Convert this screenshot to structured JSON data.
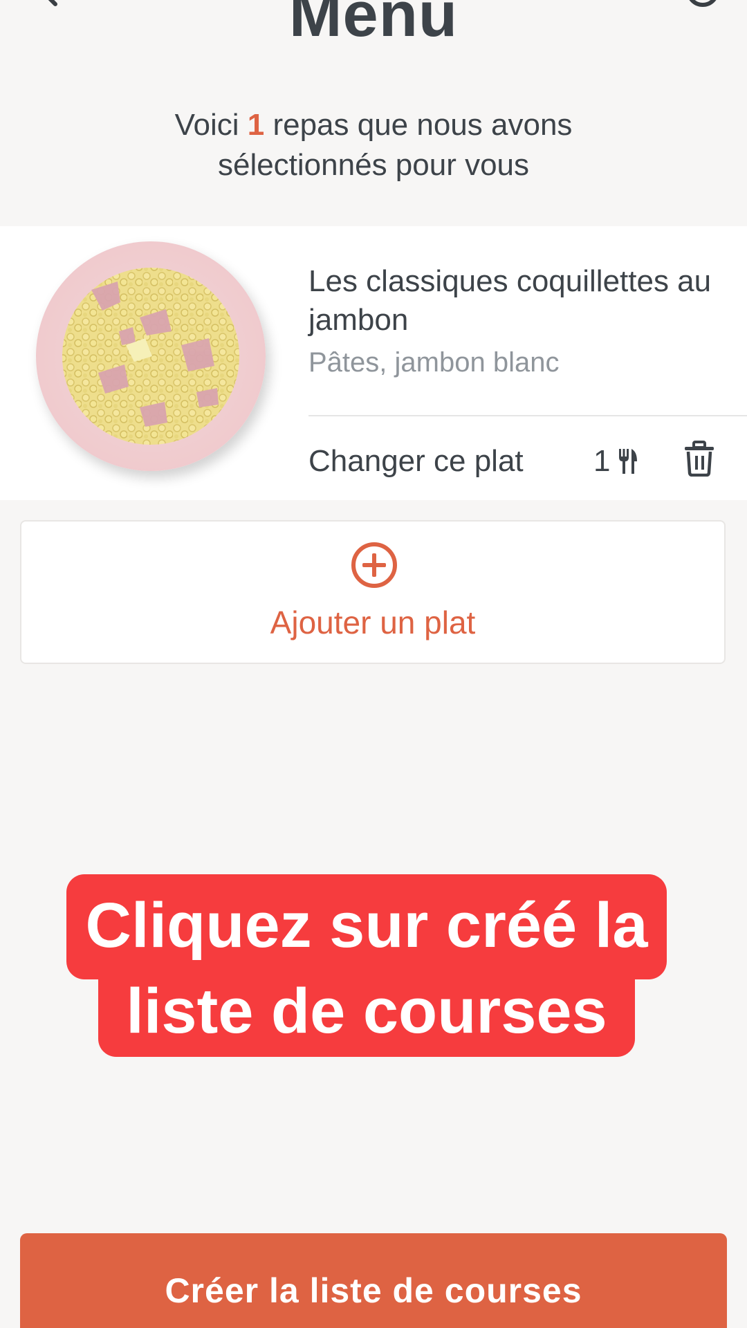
{
  "header": {
    "title": "Menu",
    "back_icon": "back-chevron-icon",
    "help_icon": "help-circle-icon"
  },
  "summary": {
    "prefix": "Voici ",
    "count": "1",
    "suffix": " repas que nous avons sélectionnés pour vous"
  },
  "meals": [
    {
      "title": "Les classiques coquillettes au jambon",
      "ingredients": "Pâtes, jambon blanc",
      "change_label": "Changer ce plat",
      "servings": "1",
      "servings_icon": "cutlery-icon",
      "delete_icon": "trash-icon",
      "image": "pasta-plate"
    }
  ],
  "add_dish": {
    "label": "Ajouter un plat",
    "icon": "plus-circle-icon"
  },
  "overlay_caption": {
    "line1": "Cliquez sur créé la",
    "line2": "liste de courses"
  },
  "cta": {
    "label": "Créer la liste de courses"
  },
  "colors": {
    "accent": "#de6343",
    "caption_bg": "#f63c3e",
    "background": "#f7f6f5",
    "text": "#3d4349",
    "muted": "#8f959b"
  }
}
